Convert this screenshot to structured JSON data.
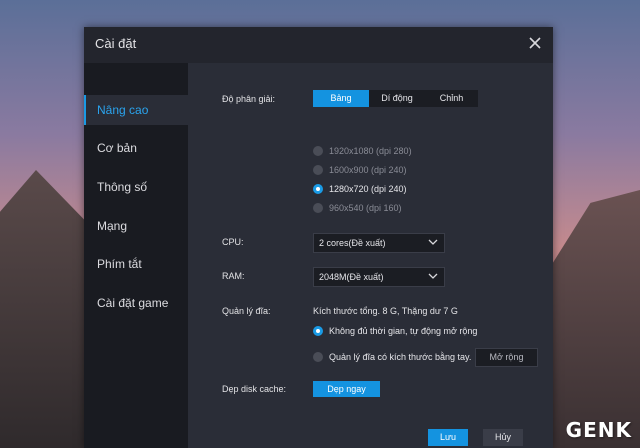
{
  "dialog": {
    "title": "Cài đặt"
  },
  "sidebar": {
    "items": [
      {
        "label": "Nâng cao",
        "active": true
      },
      {
        "label": "Cơ bản"
      },
      {
        "label": "Thông số"
      },
      {
        "label": "Mạng"
      },
      {
        "label": "Phím tắt"
      },
      {
        "label": "Cài đặt game"
      }
    ]
  },
  "resolution": {
    "label": "Độ phân giải:",
    "tabs": [
      {
        "label": "Bảng",
        "active": true
      },
      {
        "label": "Dí động"
      },
      {
        "label": "Chỉnh"
      }
    ],
    "options": [
      {
        "label": "1920x1080  (dpi 280)",
        "selected": false
      },
      {
        "label": "1600x900  (dpi 240)",
        "selected": false
      },
      {
        "label": "1280x720  (dpi 240)",
        "selected": true
      },
      {
        "label": "960x540  (dpi 160)",
        "selected": false
      }
    ]
  },
  "cpu": {
    "label": "CPU:",
    "value": "2 cores(Đề xuất)"
  },
  "ram": {
    "label": "RAM:",
    "value": "2048M(Đề xuất)"
  },
  "disk": {
    "label": "Quản lý đĩa:",
    "info": "Kích thước tổng. 8 G,  Thặng dư 7 G",
    "option_auto": "Không đủ thời gian, tự động mở rộng",
    "option_manual": "Quản lý đĩa có kích thước bằng tay.",
    "expand_button": "Mở rộng"
  },
  "cache": {
    "label": "Dẹp disk cache:",
    "button": "Dẹp ngay"
  },
  "footer": {
    "save": "Lưu",
    "cancel": "Hủy"
  },
  "watermark": "GENK",
  "colors": {
    "accent": "#1493e0",
    "panel": "#2a2d37",
    "sidebar": "#191b21"
  }
}
